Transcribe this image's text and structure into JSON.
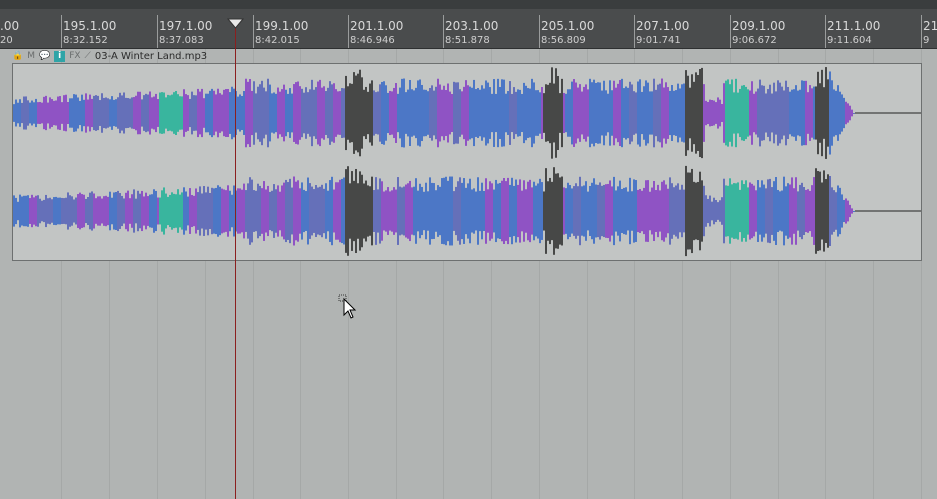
{
  "ruler": {
    "marks": [
      {
        "label": ".00",
        "time": "20"
      },
      {
        "label": "195.1.00",
        "time": "8:32.152"
      },
      {
        "label": "197.1.00",
        "time": "8:37.083"
      },
      {
        "label": "199.1.00",
        "time": "8:42.015"
      },
      {
        "label": "201.1.00",
        "time": "8:46.946"
      },
      {
        "label": "203.1.00",
        "time": "8:51.878"
      },
      {
        "label": "205.1.00",
        "time": "8:56.809"
      },
      {
        "label": "207.1.00",
        "time": "9:01.741"
      },
      {
        "label": "209.1.00",
        "time": "9:06.672"
      },
      {
        "label": "211.1.00",
        "time": "9:11.604"
      },
      {
        "label": "21",
        "time": "9"
      }
    ]
  },
  "item": {
    "title": "03-A Winter Land.mp3",
    "icons": {
      "lock": "🔒",
      "mute_label": "M",
      "note": "💬",
      "info_label": "i",
      "fx_label": "FX",
      "env": "⟋"
    }
  },
  "colors": {
    "ruler_bg": "#4a4c4d",
    "arrange_bg": "#b1b4b3",
    "item_bg": "#c2c5c4",
    "cursor": "#8b1f1f",
    "wave_teal": "#2ab39a",
    "wave_blue": "#3f6ec6",
    "wave_purple": "#8a46c4",
    "wave_dark": "#3a3a3a"
  }
}
